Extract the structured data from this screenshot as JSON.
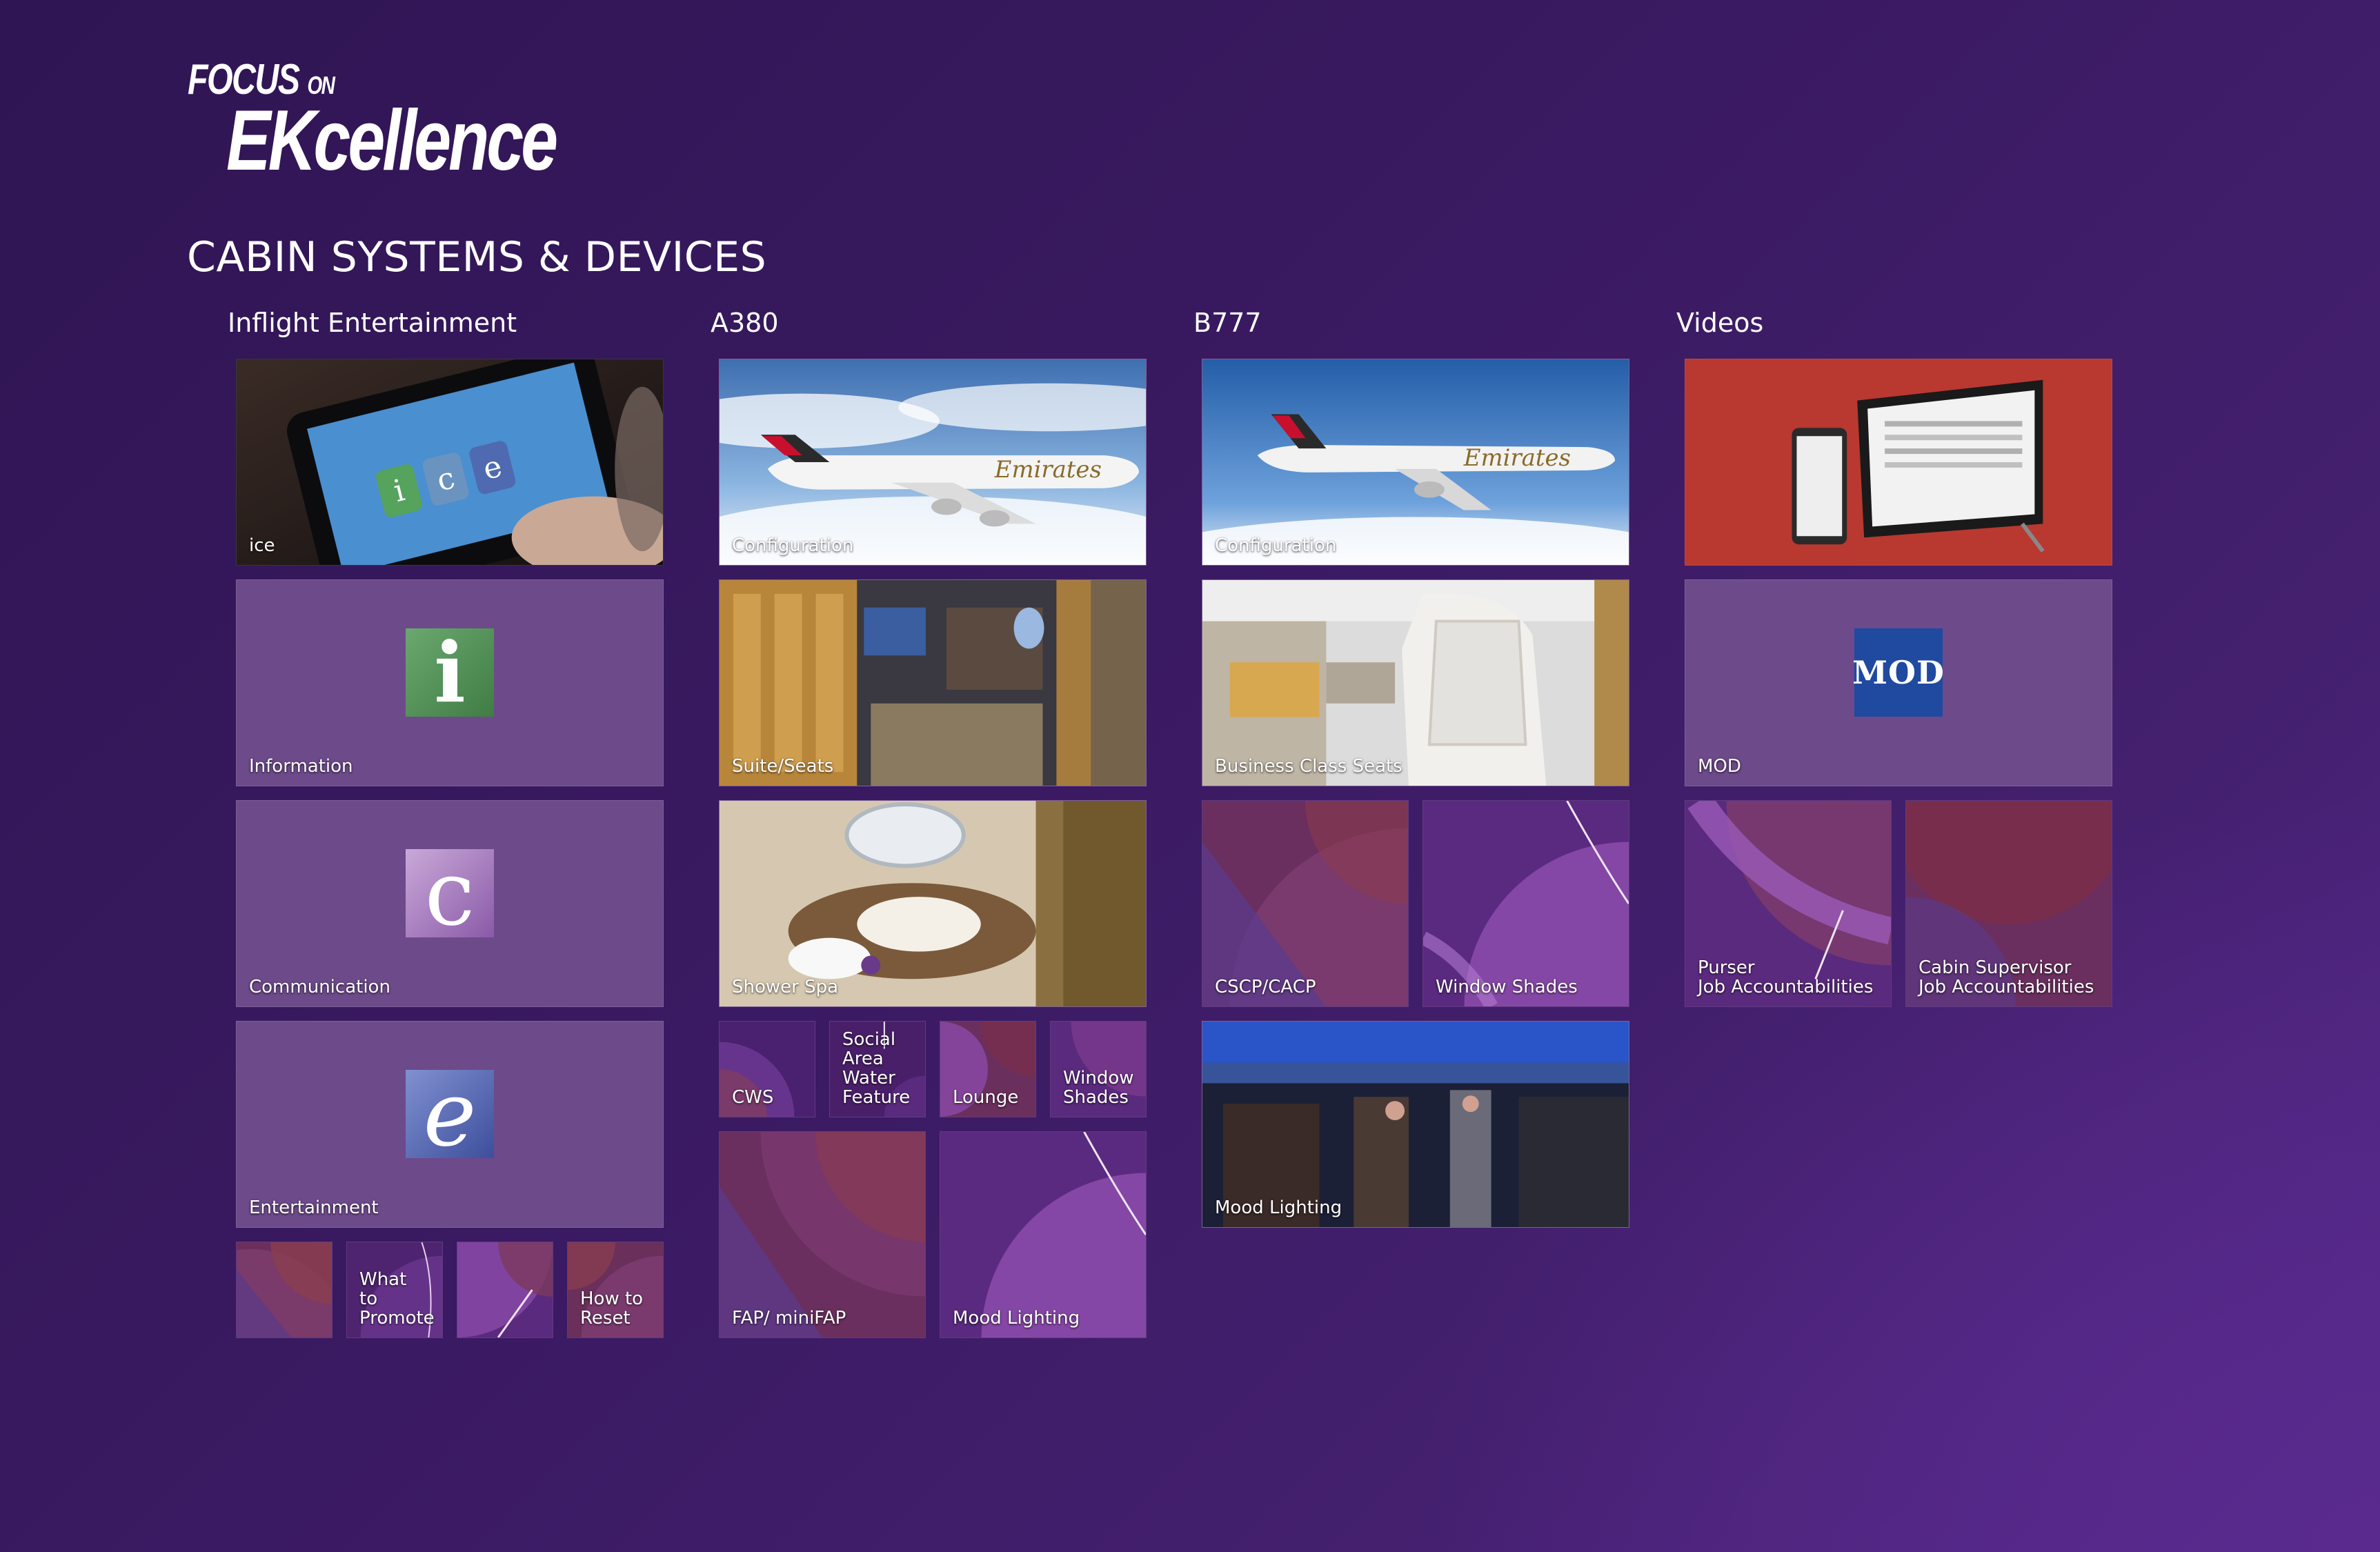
{
  "logo": {
    "line1": "FOCUS",
    "line1_small": "ON",
    "line2": "EKcellence"
  },
  "page_title": "CABIN SYSTEMS & DEVICES",
  "columns": {
    "ife": {
      "heading": "Inflight Entertainment",
      "ice": "ice",
      "information": "Information",
      "info_glyph": "i",
      "communication": "Communication",
      "comm_glyph": "c",
      "entertainment": "Entertainment",
      "ent_glyph": "e",
      "small2": "What\nto\nPromote",
      "small4": "How to\nReset"
    },
    "a380": {
      "heading": "A380",
      "configuration": "Configuration",
      "suite": "Suite/Seats",
      "spa": "Shower Spa",
      "cws": "CWS",
      "social": "Social\nArea\nWater\nFeature",
      "lounge": "Lounge",
      "shades": "Window\nShades",
      "fap": "FAP/ miniFAP",
      "mood": "Mood Lighting"
    },
    "b777": {
      "heading": "B777",
      "configuration": "Configuration",
      "business": "Business Class Seats",
      "cscp": "CSCP/CACP",
      "shades": "Window Shades",
      "mood": "Mood Lighting"
    },
    "videos": {
      "heading": "Videos",
      "mod": "MOD",
      "mod_glyph": "MOD",
      "purser": "Purser\nJob Accountabilities",
      "cabin_supervisor": "Cabin Supervisor\nJob Accountabilities"
    }
  },
  "photo_text": {
    "emirates": "Emirates"
  },
  "colors": {
    "background": "#3a1a62",
    "tile": "#6d4a8a",
    "accent_red": "#b0302b"
  }
}
